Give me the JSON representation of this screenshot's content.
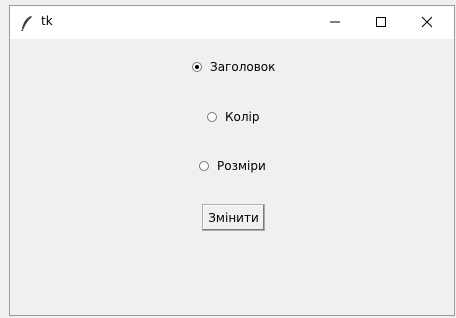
{
  "window": {
    "title": "tk",
    "icons": {
      "app": "feather-icon",
      "minimize": "minimize-icon",
      "maximize": "maximize-icon",
      "close": "close-icon"
    }
  },
  "options": [
    {
      "label": "Заголовок",
      "checked": true
    },
    {
      "label": "Колір",
      "checked": false
    },
    {
      "label": "Розміри",
      "checked": false
    }
  ],
  "button": {
    "label": "Змінити"
  }
}
